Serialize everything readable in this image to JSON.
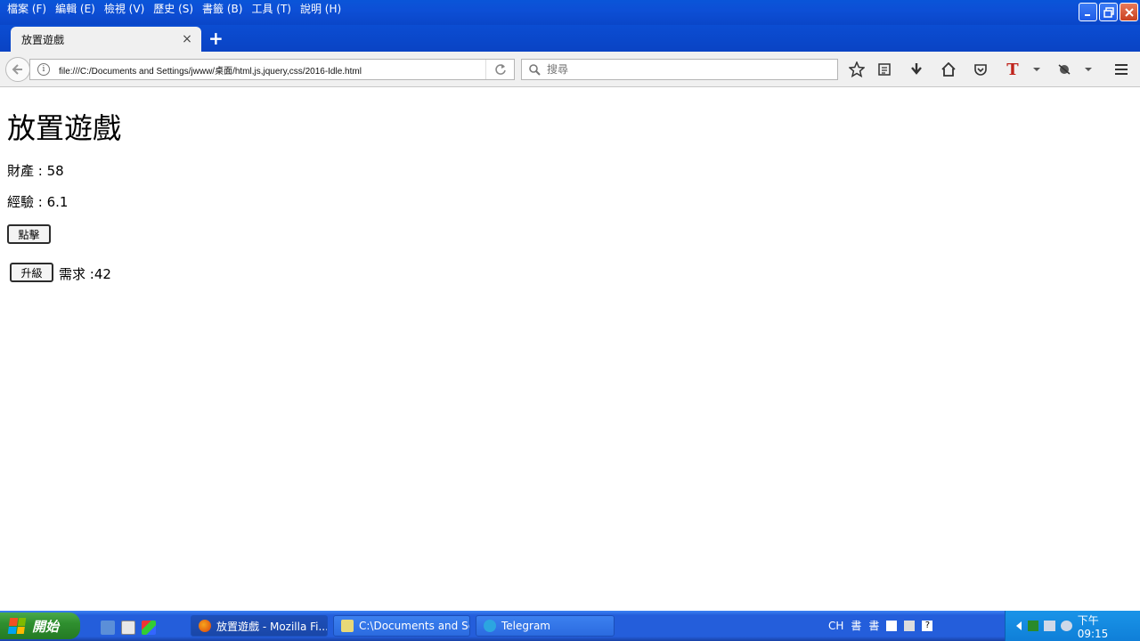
{
  "menu": {
    "items": [
      "檔案 (F)",
      "編輯 (E)",
      "檢視 (V)",
      "歷史 (S)",
      "書籤 (B)",
      "工具 (T)",
      "說明 (H)"
    ]
  },
  "tab": {
    "title": "放置遊戲",
    "close": "×",
    "new_tab": "+"
  },
  "nav": {
    "url": "file:///C:/Documents and Settings/jwww/桌面/html,js,jquery,css/2016-Idle.html",
    "search_placeholder": "搜尋"
  },
  "page": {
    "heading": "放置遊戲",
    "wealth": "財產 : 58",
    "experience": "經驗 : 6.1",
    "click_button": "點擊",
    "upgrade_button": "升級",
    "requirement": "需求 :42"
  },
  "taskbar": {
    "start_label": "開始",
    "tasks": [
      {
        "label": "放置遊戲 - Mozilla Fi...",
        "icon": "firefox-icon"
      },
      {
        "label": "C:\\Documents and Sett...",
        "icon": "notepad-icon"
      },
      {
        "label": "Telegram",
        "icon": "telegram-icon"
      }
    ],
    "ime": {
      "lang": "CH",
      "ime1": "書",
      "ime2": "書"
    },
    "clock": "下午 09:15"
  }
}
